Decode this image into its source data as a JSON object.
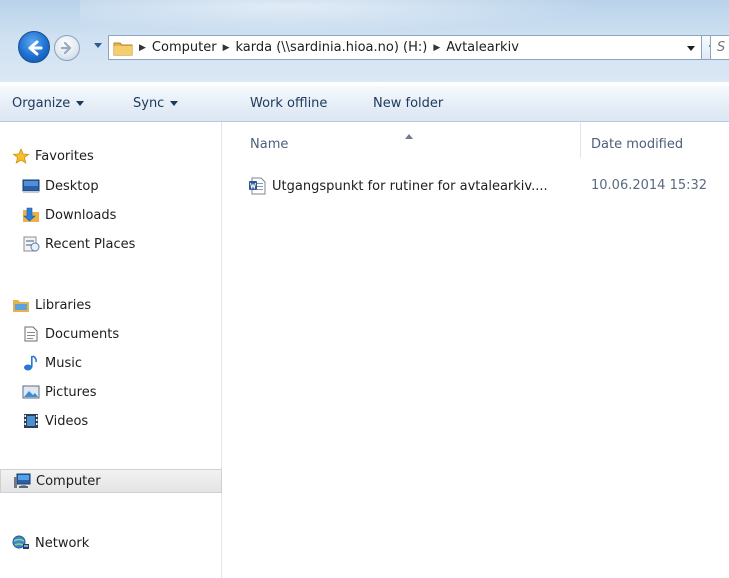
{
  "address_bar": {
    "crumbs": [
      "Computer",
      "karda (\\\\sardinia.hioa.no) (H:)",
      "Avtalearkiv"
    ],
    "search_placeholder": "S"
  },
  "toolbar": {
    "organize": "Organize",
    "sync": "Sync",
    "work_offline": "Work offline",
    "new_folder": "New folder"
  },
  "nav_pane": {
    "favorites": {
      "label": "Favorites",
      "items": [
        "Desktop",
        "Downloads",
        "Recent Places"
      ]
    },
    "libraries": {
      "label": "Libraries",
      "items": [
        "Documents",
        "Music",
        "Pictures",
        "Videos"
      ]
    },
    "computer": "Computer",
    "network": "Network"
  },
  "file_list": {
    "columns": {
      "name": "Name",
      "date_modified": "Date modified"
    },
    "rows": [
      {
        "name": "Utgangspunkt for rutiner for avtalearkiv....",
        "date_modified": "10.06.2014 15:32",
        "icon": "word-document-icon"
      }
    ]
  },
  "colors": {
    "accent": "#1d6fd0",
    "toolbar_text": "#1e395b",
    "header_text": "#4c607a"
  }
}
